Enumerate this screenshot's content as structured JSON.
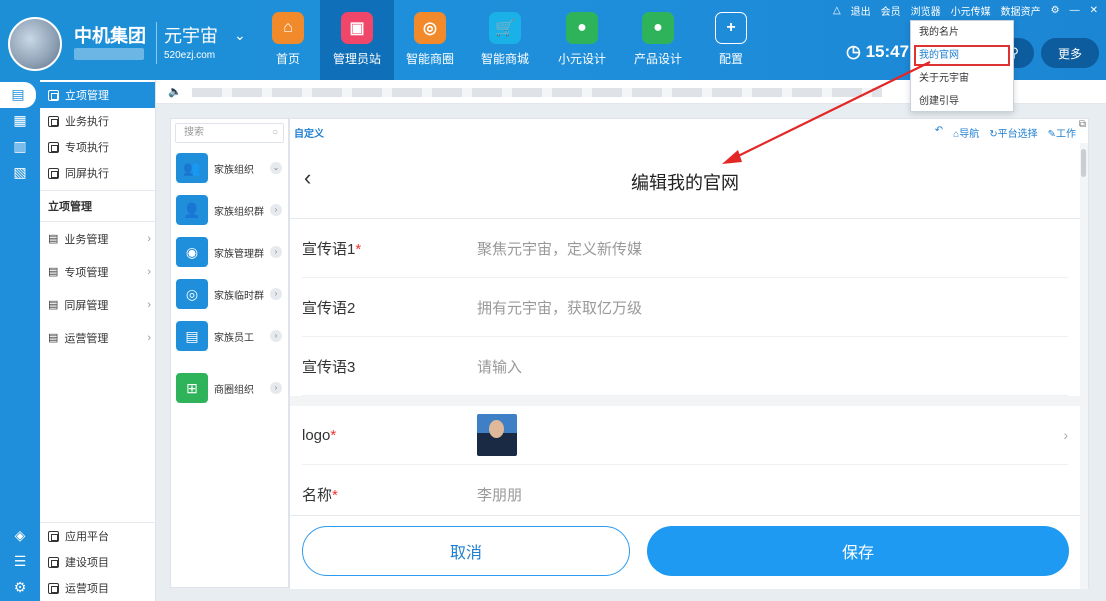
{
  "header": {
    "org_name": "中机集团",
    "brand_name": "元宇宙",
    "brand_url": "520ezj.com",
    "clock": "15:47",
    "more_label": "更多",
    "nav": [
      {
        "label": "首页",
        "icon": "home-icon",
        "color": "#f08a2a"
      },
      {
        "label": "管理员站",
        "icon": "admin-monitor-icon",
        "color": "#f0466a"
      },
      {
        "label": "智能商圈",
        "icon": "smart-circle-icon",
        "color": "#f28a2b"
      },
      {
        "label": "智能商城",
        "icon": "cart-icon",
        "color": "#1ab0e8"
      },
      {
        "label": "小元设计",
        "icon": "design-icon",
        "color": "#2fb35a"
      },
      {
        "label": "产品设计",
        "icon": "product-design-icon",
        "color": "#2fb35a"
      },
      {
        "label": "配置",
        "icon": "plus-icon",
        "color": "#1f8fdb"
      }
    ],
    "top_links": [
      "退出",
      "会员",
      "浏览器",
      "小元传媒",
      "数据资产"
    ]
  },
  "dropdown": {
    "items": [
      "我的名片",
      "我的官网",
      "关于元宇宙",
      "创建引导"
    ]
  },
  "sidebar": {
    "top_items": [
      "立项管理",
      "业务执行",
      "专项执行",
      "同屏执行"
    ],
    "section_title": "立项管理",
    "groups": [
      "业务管理",
      "专项管理",
      "同屏管理",
      "运营管理"
    ],
    "bottom_items": [
      "应用平台",
      "建设项目",
      "运营项目"
    ]
  },
  "org_panel": {
    "search_placeholder": "搜索",
    "items": [
      {
        "label": "家族组织",
        "color": "#1f8fdb"
      },
      {
        "label": "家族组织群",
        "color": "#1f8fdb"
      },
      {
        "label": "家族管理群",
        "color": "#1f8fdb"
      },
      {
        "label": "家族临时群",
        "color": "#1f8fdb"
      },
      {
        "label": "家族员工",
        "color": "#1f8fdb"
      },
      {
        "label": "商圈组织",
        "color": "#2fb35a"
      }
    ]
  },
  "main": {
    "custom_label": "自定义",
    "tools": [
      "导航",
      "平台选择",
      "工作"
    ],
    "title": "编辑我的官网",
    "fields": [
      {
        "label": "宣传语1",
        "required": true,
        "value": "聚焦元宇宙，定义新传媒"
      },
      {
        "label": "宣传语2",
        "required": false,
        "value": "拥有元宇宙，获取亿万级"
      },
      {
        "label": "宣传语3",
        "required": false,
        "value": "请输入"
      }
    ],
    "logo_label": "logo",
    "name_label": "名称",
    "name_value": "李朋朋",
    "cancel_label": "取消",
    "save_label": "保存"
  }
}
